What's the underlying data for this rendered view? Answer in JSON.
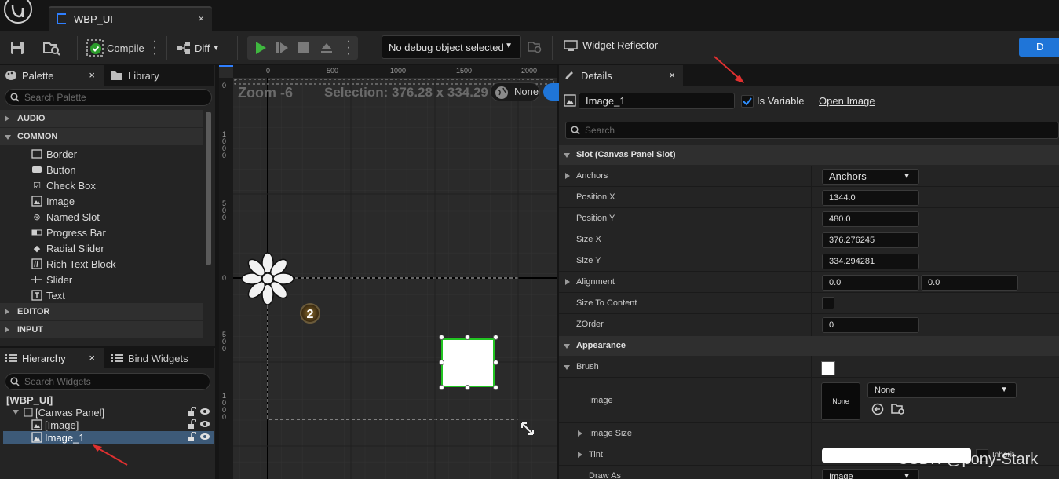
{
  "tab": {
    "title": "WBP_UI",
    "close": "×"
  },
  "toolbar": {
    "compile": "Compile",
    "diff": "Diff",
    "debug_object": "No debug object selected",
    "widget_reflector": "Widget Reflector",
    "right_button": "D"
  },
  "palette": {
    "tab_label": "Palette",
    "tab_close": "×",
    "library_label": "Library",
    "search_placeholder": "Search Palette",
    "categories": [
      "AUDIO",
      "COMMON",
      "EDITOR",
      "INPUT"
    ],
    "common_items": [
      {
        "label": "Border",
        "icon": "border-icon"
      },
      {
        "label": "Button",
        "icon": "button-icon"
      },
      {
        "label": "Check Box",
        "icon": "checkbox-icon"
      },
      {
        "label": "Image",
        "icon": "image-icon"
      },
      {
        "label": "Named Slot",
        "icon": "named-slot-icon"
      },
      {
        "label": "Progress Bar",
        "icon": "progress-bar-icon"
      },
      {
        "label": "Radial Slider",
        "icon": "radial-slider-icon"
      },
      {
        "label": "Rich Text Block",
        "icon": "rich-text-icon"
      },
      {
        "label": "Slider",
        "icon": "slider-icon"
      },
      {
        "label": "Text",
        "icon": "text-icon"
      }
    ]
  },
  "hierarchy": {
    "tab_label": "Hierarchy",
    "tab_close": "×",
    "bind_label": "Bind Widgets",
    "search_placeholder": "Search Widgets",
    "root": "[WBP_UI]",
    "canvas_panel": "[Canvas Panel]",
    "items": [
      "[Image]",
      "Image_1"
    ]
  },
  "canvas": {
    "zoom": "Zoom -6",
    "selection": "Selection: 376.28 x 334.29",
    "screen_size": "None",
    "ruler_top": [
      "0",
      "500",
      "1000",
      "1500",
      "2000"
    ],
    "ruler_left": [
      "0",
      "1\n0\n0\n0",
      "5\n0\n0",
      "0",
      "5\n0\n0",
      "1\n0\n0\n0"
    ],
    "badge": "2"
  },
  "details": {
    "tab_label": "Details",
    "tab_close": "×",
    "widget_name": "Image_1",
    "is_variable_label": "Is Variable",
    "is_variable": true,
    "open_image": "Open Image",
    "search_placeholder": "Search",
    "slot_section": "Slot (Canvas Panel Slot)",
    "anchors_label": "Anchors",
    "anchors_value": "Anchors",
    "position_x_label": "Position X",
    "position_x": "1344.0",
    "position_y_label": "Position Y",
    "position_y": "480.0",
    "size_x_label": "Size X",
    "size_x": "376.276245",
    "size_y_label": "Size Y",
    "size_y": "334.294281",
    "alignment_label": "Alignment",
    "alignment_x": "0.0",
    "alignment_y": "0.0",
    "size_to_content_label": "Size To Content",
    "zorder_label": "ZOrder",
    "zorder": "0",
    "appearance_section": "Appearance",
    "brush_label": "Brush",
    "image_label": "Image",
    "image_thumb": "None",
    "image_select": "None",
    "image_size_label": "Image Size",
    "tint_label": "Tint",
    "tint_inherit": "Inherit",
    "draw_as_label": "Draw As",
    "draw_as": "Image"
  },
  "watermark": "CSDN @pony-Stark",
  "colors": {
    "accent_blue": "#1f75d8",
    "selection_green": "#22c422",
    "annotation_red": "#e03030"
  }
}
